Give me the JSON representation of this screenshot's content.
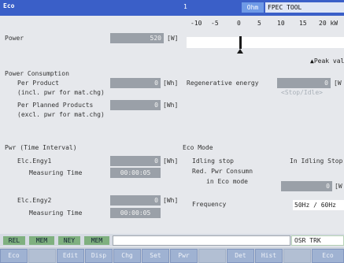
{
  "titlebar": {
    "app": "Eco",
    "number": "1",
    "mode": "Ohm",
    "cnc": "FPEC TOOL"
  },
  "scale": {
    "ticks": [
      "-10",
      "-5",
      "0",
      "5",
      "10",
      "15",
      "20 kW"
    ],
    "legend": "Peak val"
  },
  "power": {
    "label": "Power",
    "value": "520",
    "unit": "[W]"
  },
  "consumption": {
    "heading": "Power Consumption",
    "per_product_label": "Per Product",
    "per_product_value": "0",
    "per_product_unit": "[Wh]",
    "per_product_note": "(incl. pwr for mat.chg)",
    "planned_label": "Per Planned Products",
    "planned_value": "0",
    "planned_unit": "[Wh]",
    "planned_note": "(excl. pwr for mat.chg)",
    "regen_label": "Regenerative energy",
    "regen_value": "0",
    "regen_unit": "[W",
    "regen_note": "<Stop/Idle>"
  },
  "interval": {
    "heading": "Pwr (Time Interval)",
    "e1_label": "Elc.Engy1",
    "e1_value": "0",
    "e1_unit": "[Wh]",
    "e1_time_label": "Measuring Time",
    "e1_time": "00:00:05",
    "e2_label": "Elc.Engy2",
    "e2_value": "0",
    "e2_unit": "[Wh]",
    "e2_time_label": "Measuring Time",
    "e2_time": "00:00:05"
  },
  "eco": {
    "heading": "Eco Mode",
    "idling_label": "Idling stop",
    "idling_value": "In Idling Stop",
    "red_label": "Red. Pwr Consumn",
    "red_label2": "in Eco mode",
    "red_value": "0",
    "red_unit": "[W",
    "freq_label": "Frequency",
    "freq_value": "50Hz / 60Hz"
  },
  "status": {
    "indicators": [
      "REL",
      "MEM",
      "NEY",
      "MEM"
    ],
    "edit": "OSR TRK"
  },
  "softkeys": [
    "Eco",
    "",
    "Edit",
    "Disp",
    "Chg",
    "Set",
    "Pwr",
    "",
    "Det",
    "Hist",
    "",
    "Eco"
  ]
}
